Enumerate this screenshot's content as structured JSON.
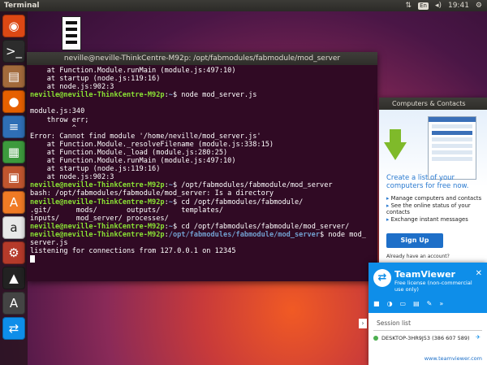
{
  "top_panel": {
    "title": "Terminal",
    "keyboard": "En",
    "time": "19:41"
  },
  "launcher": {
    "items": [
      {
        "name": "ubuntu-icon",
        "glyph": "◉",
        "bg": "#dd4814"
      },
      {
        "name": "terminal-icon",
        "glyph": ">_",
        "bg": "#2c2c2c"
      },
      {
        "name": "files-icon",
        "glyph": "▤",
        "bg": "#a26a3b"
      },
      {
        "name": "firefox-icon",
        "glyph": "●",
        "bg": "#e66000"
      },
      {
        "name": "writer-icon",
        "glyph": "≡",
        "bg": "#2f6fb6"
      },
      {
        "name": "calc-icon",
        "glyph": "▦",
        "bg": "#3d9a3d"
      },
      {
        "name": "impress-icon",
        "glyph": "▣",
        "bg": "#c0552f"
      },
      {
        "name": "software-center-icon",
        "glyph": "A",
        "bg": "#f07a25"
      },
      {
        "name": "amazon-icon",
        "glyph": "a",
        "bg": "#e8e8e8"
      },
      {
        "name": "settings-icon",
        "glyph": "⚙",
        "bg": "#b53a2a"
      },
      {
        "name": "inkscape-icon",
        "glyph": "▲",
        "bg": "#222222"
      },
      {
        "name": "updater-icon",
        "glyph": "A",
        "bg": "#444444"
      },
      {
        "name": "teamviewer-launcher-icon",
        "glyph": "⇄",
        "bg": "#0e8ee9"
      }
    ]
  },
  "terminal": {
    "title": "neville@neville-ThinkCentre-M92p: /opt/fabmodules/fabmodule/mod_server",
    "lines": [
      {
        "text": "    at Function.Module.runMain (module.js:497:10)"
      },
      {
        "text": "    at startup (node.js:119:16)"
      },
      {
        "text": "    at node.js:902:3"
      },
      {
        "user": "neville@neville-ThinkCentre-M92p",
        "path": "~",
        "cmd": "$ node mod_server.js"
      },
      {
        "text": ""
      },
      {
        "text": "module.js:340"
      },
      {
        "text": "    throw err;"
      },
      {
        "text": "          ^"
      },
      {
        "text": "Error: Cannot find module '/home/neville/mod_server.js'"
      },
      {
        "text": "    at Function.Module._resolveFilename (module.js:338:15)"
      },
      {
        "text": "    at Function.Module._load (module.js:280:25)"
      },
      {
        "text": "    at Function.Module.runMain (module.js:497:10)"
      },
      {
        "text": "    at startup (node.js:119:16)"
      },
      {
        "text": "    at node.js:902:3"
      },
      {
        "user": "neville@neville-ThinkCentre-M92p",
        "path": "~",
        "cmd": "$ /opt/fabmodules/fabmodule/mod_server"
      },
      {
        "text": "bash: /opt/fabmodules/fabmodule/mod_server: Is a directory"
      },
      {
        "user": "neville@neville-ThinkCentre-M92p",
        "path": "~",
        "cmd": "$ cd /opt/fabmodules/fabmodule/"
      },
      {
        "text": ".git/      mods/       outputs/     templates/"
      },
      {
        "text": "inputs/    mod_server/ processes/"
      },
      {
        "user": "neville@neville-ThinkCentre-M92p",
        "path": "~",
        "cmd": "$ cd /opt/fabmodules/fabmodule/mod_server/"
      },
      {
        "user": "neville@neville-ThinkCentre-M92p",
        "path": "/opt/fabmodules/fabmodule/mod_server",
        "cmd": "$ node mod_"
      },
      {
        "text": "server.js"
      },
      {
        "text": "listening for connections from 127.0.0.1 on 12345"
      }
    ]
  },
  "ad": {
    "title": "Computers & Contacts",
    "headline": "Create a list of your computers for free now.",
    "bullets": [
      "Manage computers and contacts",
      "See the online status of your contacts",
      "Exchange instant messages"
    ],
    "signup_label": "Sign Up",
    "account_text": "Already have an account?"
  },
  "teamviewer": {
    "name": "TeamViewer",
    "license": "Free license (non-commercial use only)",
    "session_label": "Session list",
    "device": "DESKTOP-3HR9J53 (386 607 589)",
    "link": "www.teamviewer.com"
  }
}
